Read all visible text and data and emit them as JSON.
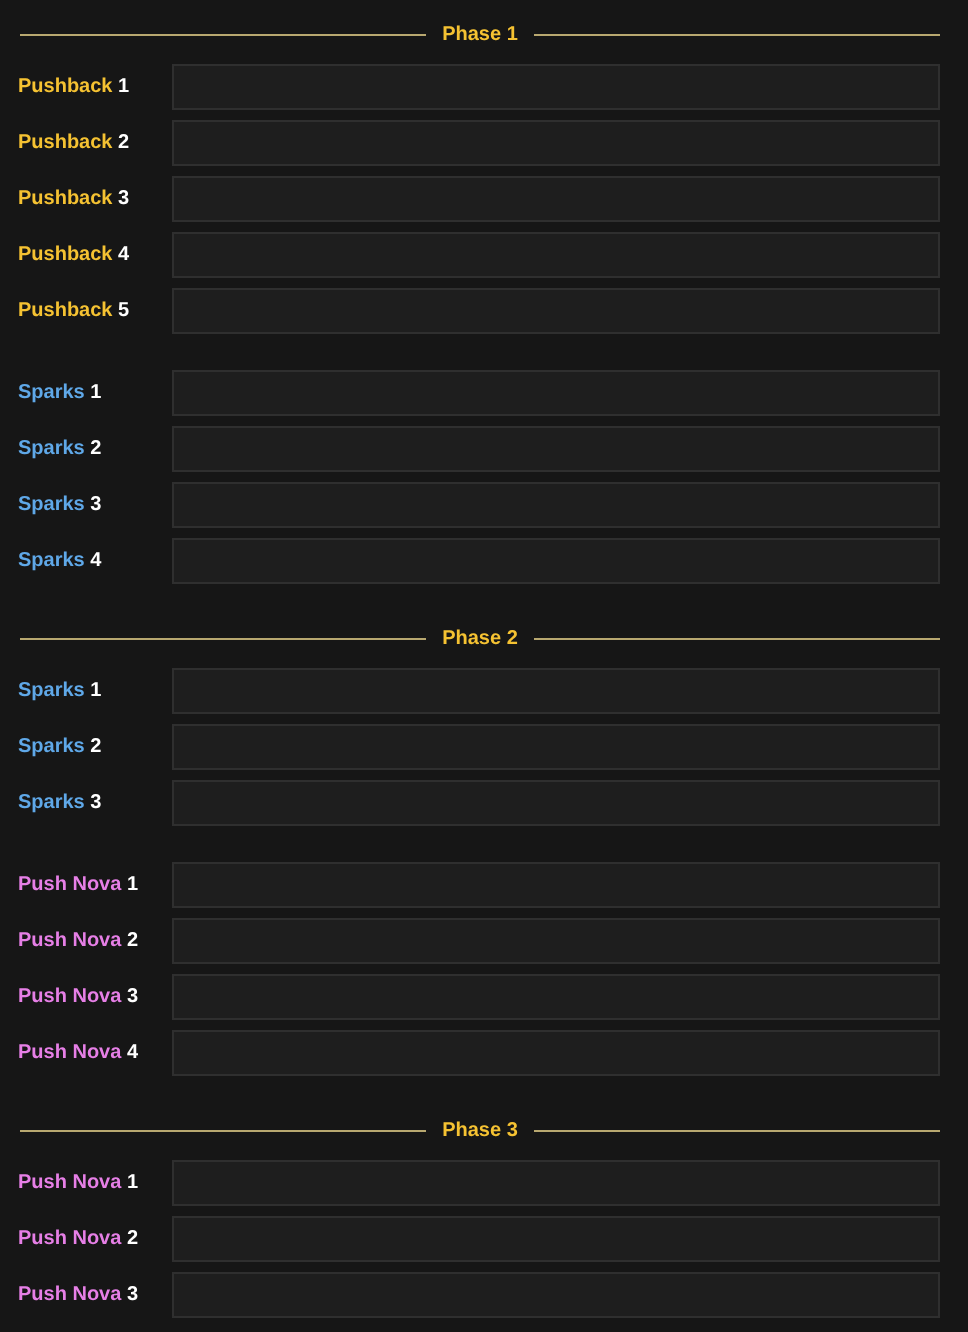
{
  "sections": [
    {
      "title": "Phase 1",
      "groups": [
        {
          "color": "#f5c232",
          "rows": [
            {
              "name": "Pushback",
              "number": "1"
            },
            {
              "name": "Pushback",
              "number": "2"
            },
            {
              "name": "Pushback",
              "number": "3"
            },
            {
              "name": "Pushback",
              "number": "4"
            },
            {
              "name": "Pushback",
              "number": "5"
            }
          ]
        },
        {
          "color": "#5fa8e8",
          "rows": [
            {
              "name": "Sparks",
              "number": "1"
            },
            {
              "name": "Sparks",
              "number": "2"
            },
            {
              "name": "Sparks",
              "number": "3"
            },
            {
              "name": "Sparks",
              "number": "4"
            }
          ]
        }
      ]
    },
    {
      "title": "Phase 2",
      "groups": [
        {
          "color": "#5fa8e8",
          "rows": [
            {
              "name": "Sparks",
              "number": "1"
            },
            {
              "name": "Sparks",
              "number": "2"
            },
            {
              "name": "Sparks",
              "number": "3"
            }
          ]
        },
        {
          "color": "#e67fe6",
          "rows": [
            {
              "name": "Push Nova",
              "number": "1"
            },
            {
              "name": "Push Nova",
              "number": "2"
            },
            {
              "name": "Push Nova",
              "number": "3"
            },
            {
              "name": "Push Nova",
              "number": "4"
            }
          ]
        }
      ]
    },
    {
      "title": "Phase 3",
      "groups": [
        {
          "color": "#e67fe6",
          "rows": [
            {
              "name": "Push Nova",
              "number": "1"
            },
            {
              "name": "Push Nova",
              "number": "2"
            },
            {
              "name": "Push Nova",
              "number": "3"
            }
          ]
        }
      ]
    }
  ]
}
